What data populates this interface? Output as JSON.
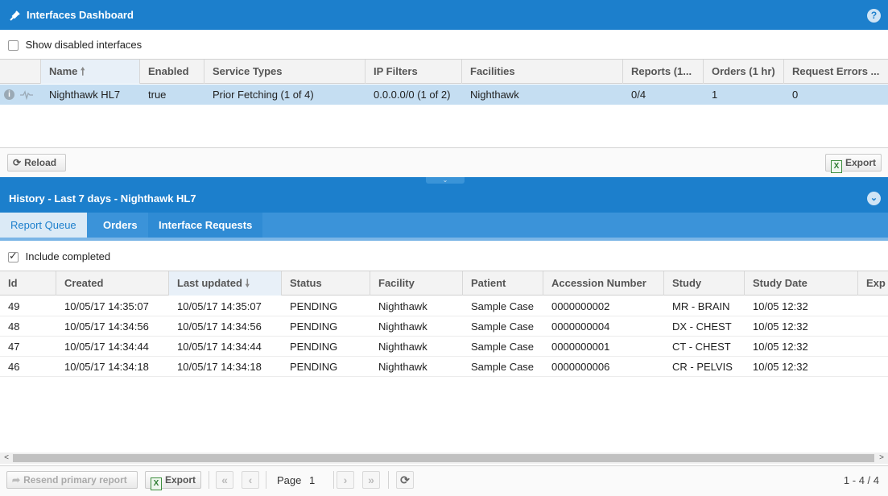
{
  "header": {
    "title": "Interfaces Dashboard",
    "help_icon": "?"
  },
  "show_disabled": {
    "label": "Show disabled interfaces",
    "checked": false
  },
  "interfaces": {
    "columns": [
      "Name",
      "Enabled",
      "Service Types",
      "IP Filters",
      "Facilities",
      "Reports (1...",
      "Orders (1 hr)",
      "Request Errors ..."
    ],
    "rows": [
      {
        "name": "Nighthawk HL7",
        "enabled": "true",
        "service_types": "Prior Fetching (1 of 4)",
        "ip_filters": "0.0.0.0/0 (1 of 2)",
        "facilities": "Nighthawk",
        "reports": "0/4",
        "orders": "1",
        "request_errors": "0"
      }
    ]
  },
  "top_toolbar": {
    "reload": "Reload",
    "export": "Export"
  },
  "history": {
    "title": "History - Last 7 days - Nighthawk HL7",
    "tabs": [
      "Report Queue",
      "Orders",
      "Interface Requests"
    ],
    "active_tab": "Report Queue",
    "include_completed": {
      "label": "Include completed",
      "checked": true
    },
    "columns": [
      "Id",
      "Created",
      "Last updated",
      "Status",
      "Facility",
      "Patient",
      "Accession Number",
      "Study",
      "Study Date",
      "Exp"
    ],
    "rows": [
      {
        "id": "49",
        "created": "10/05/17 14:35:07",
        "updated": "10/05/17 14:35:07",
        "status": "PENDING",
        "facility": "Nighthawk",
        "patient": "Sample Case",
        "accession": "0000000002",
        "study": "MR - BRAIN",
        "study_date": "10/05 12:32"
      },
      {
        "id": "48",
        "created": "10/05/17 14:34:56",
        "updated": "10/05/17 14:34:56",
        "status": "PENDING",
        "facility": "Nighthawk",
        "patient": "Sample Case",
        "accession": "0000000004",
        "study": "DX - CHEST",
        "study_date": "10/05 12:32"
      },
      {
        "id": "47",
        "created": "10/05/17 14:34:44",
        "updated": "10/05/17 14:34:44",
        "status": "PENDING",
        "facility": "Nighthawk",
        "patient": "Sample Case",
        "accession": "0000000001",
        "study": "CT - CHEST",
        "study_date": "10/05 12:32"
      },
      {
        "id": "46",
        "created": "10/05/17 14:34:18",
        "updated": "10/05/17 14:34:18",
        "status": "PENDING",
        "facility": "Nighthawk",
        "patient": "Sample Case",
        "accession": "0000000006",
        "study": "CR - PELVIS",
        "study_date": "10/05 12:32"
      }
    ]
  },
  "bottom_toolbar": {
    "resend": "Resend primary report",
    "export": "Export",
    "page_label": "Page",
    "page_value": "1",
    "range": "1 - 4 / 4"
  }
}
